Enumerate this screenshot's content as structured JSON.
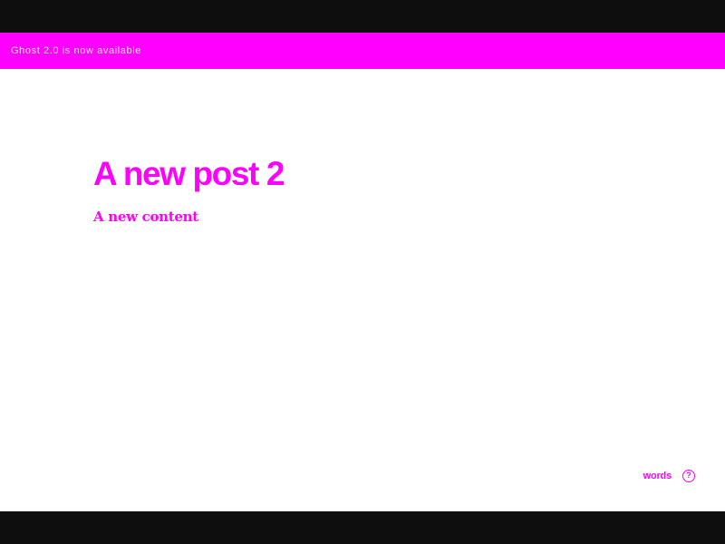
{
  "banner": {
    "text": "Ghost 2.0 is now available"
  },
  "post": {
    "title": "A new post 2",
    "content": "A new content"
  },
  "footer": {
    "word_count_label": "words",
    "help_icon_glyph": "?"
  },
  "colors": {
    "accent": "#ff00ff",
    "frame": "#0e0e0e",
    "canvas": "#ffffff"
  }
}
